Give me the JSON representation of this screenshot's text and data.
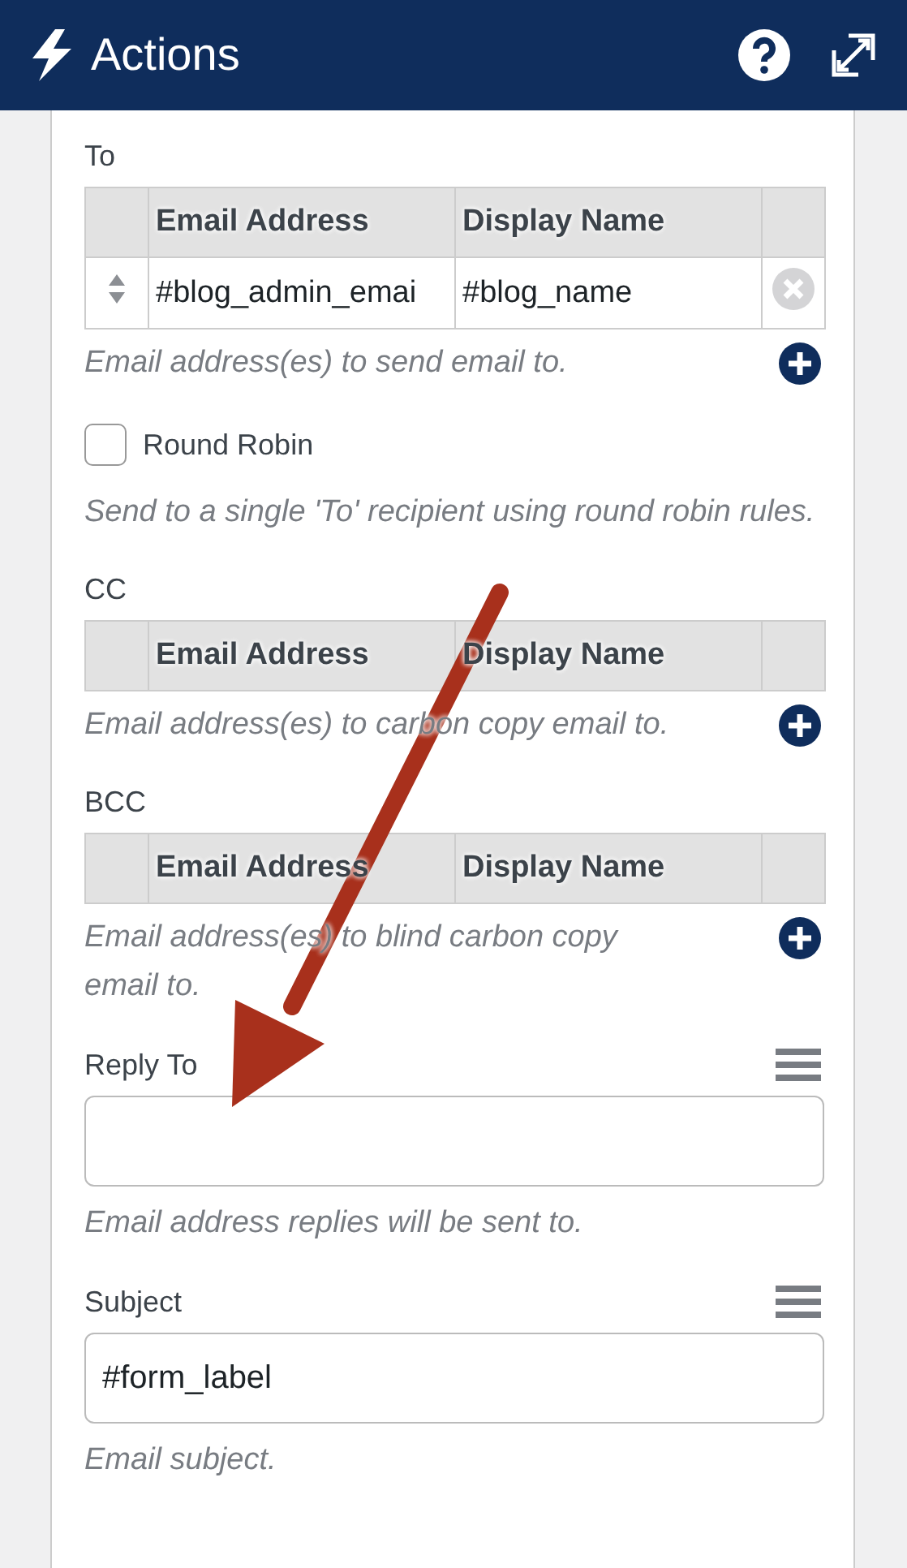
{
  "header": {
    "title": "Actions"
  },
  "sections": [
    {
      "kind": "table",
      "label": "To",
      "columns": [
        "Email Address",
        "Display Name"
      ],
      "rows": [
        [
          "#blog_admin_emai",
          "#blog_name"
        ]
      ],
      "help": "Email address(es) to send email to."
    },
    {
      "kind": "checkbox",
      "label": "Round Robin",
      "checked": false,
      "help": "Send to a single 'To' recipient using round robin rules."
    },
    {
      "kind": "table",
      "label": "CC",
      "columns": [
        "Email Address",
        "Display Name"
      ],
      "help": "Email address(es) to carbon copy email to."
    },
    {
      "kind": "table",
      "label": "BCC",
      "columns": [
        "Email Address",
        "Display Name"
      ],
      "help": "Email address(es) to blind carbon copy email to."
    },
    {
      "kind": "text",
      "label": "Reply To",
      "help": "Email address replies will be sent to."
    },
    {
      "kind": "text",
      "label": "Subject",
      "value": "#form_label",
      "help": "Email subject."
    }
  ]
}
